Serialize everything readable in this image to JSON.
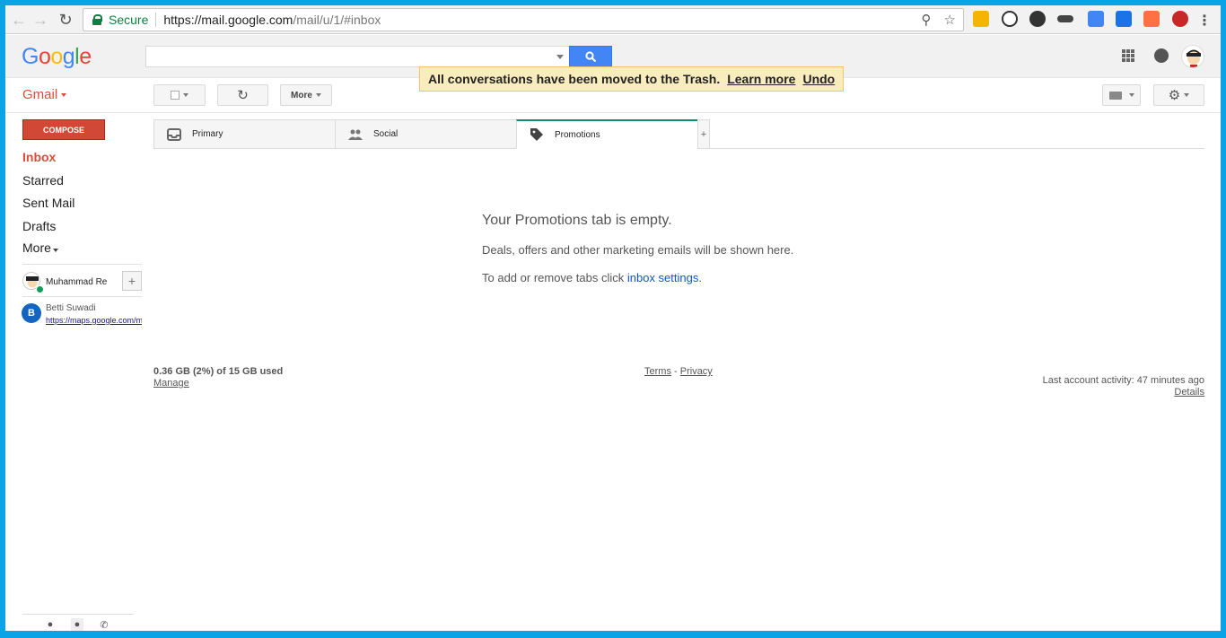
{
  "browser": {
    "secure_label": "Secure",
    "url_host": "https://mail.google.com",
    "url_path": "/mail/u/1/#inbox"
  },
  "header": {
    "logo": [
      "G",
      "o",
      "o",
      "g",
      "l",
      "e"
    ],
    "logo_colors": [
      "#4285f4",
      "#ea4335",
      "#fbbc05",
      "#4285f4",
      "#34a853",
      "#ea4335"
    ]
  },
  "toast": {
    "message": "All conversations have been moved to the Trash.",
    "learn_more": "Learn more",
    "undo": "Undo"
  },
  "toolbar": {
    "app_label": "Gmail",
    "more_label": "More"
  },
  "sidebar": {
    "compose_label": "COMPOSE",
    "items": [
      {
        "label": "Inbox",
        "active": true
      },
      {
        "label": "Starred"
      },
      {
        "label": "Sent Mail"
      },
      {
        "label": "Drafts"
      },
      {
        "label": "More"
      }
    ],
    "hangouts_user": "Muhammad Re",
    "contact_initial": "B",
    "contact_name": "Betti Suwadi",
    "contact_link": "https://maps.google.com/ma"
  },
  "tabs": [
    {
      "label": "Primary",
      "icon": "inbox-icon"
    },
    {
      "label": "Social",
      "icon": "people-icon"
    },
    {
      "label": "Promotions",
      "icon": "tag-icon",
      "selected": true
    }
  ],
  "empty_state": {
    "title": "Your Promotions tab is empty.",
    "line1": "Deals, offers and other marketing emails will be shown here.",
    "line2_prefix": "To add or remove tabs click ",
    "line2_link": "inbox settings",
    "line2_suffix": "."
  },
  "footer": {
    "storage": "0.36 GB (2%) of 15 GB used",
    "manage": "Manage",
    "terms": "Terms",
    "dash": "-",
    "privacy": "Privacy",
    "activity": "Last account activity: 47 minutes ago",
    "details": "Details"
  },
  "colors": {
    "compose": "#d14836",
    "search_button": "#4285f4",
    "active_nav": "#dd4b39",
    "selected_tab": "#138a72",
    "toast_bg": "#f9edbe"
  }
}
